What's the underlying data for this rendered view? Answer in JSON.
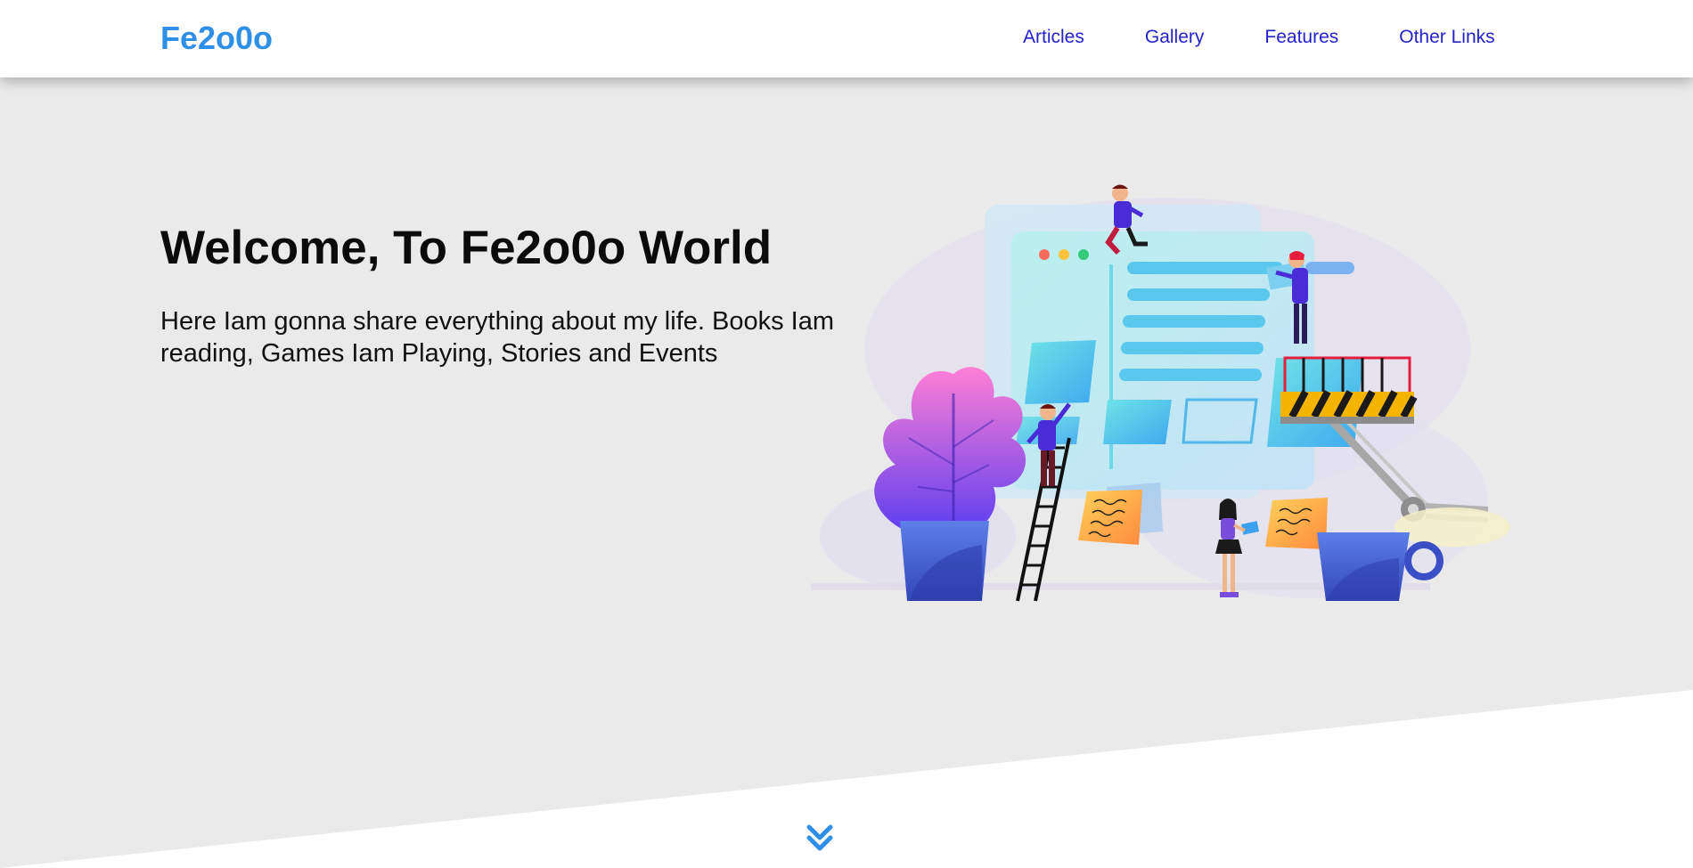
{
  "navbar": {
    "brand": "Fe2o0o",
    "links": [
      {
        "label": "Articles"
      },
      {
        "label": "Gallery"
      },
      {
        "label": "Features"
      },
      {
        "label": "Other Links"
      }
    ]
  },
  "hero": {
    "title": "Welcome, To Fe2o0o World",
    "description": "Here Iam gonna share everything about my life. Books Iam reading, Games Iam Playing, Stories and Events"
  },
  "icons": {
    "scroll": "double-chevron-down-icon",
    "illustration": "website-building-illustration"
  },
  "colors": {
    "brand": "#2d8fe6",
    "nav_link": "#2323c8",
    "hero_bg": "#eaeaea",
    "chevron": "#2d8fe6"
  }
}
